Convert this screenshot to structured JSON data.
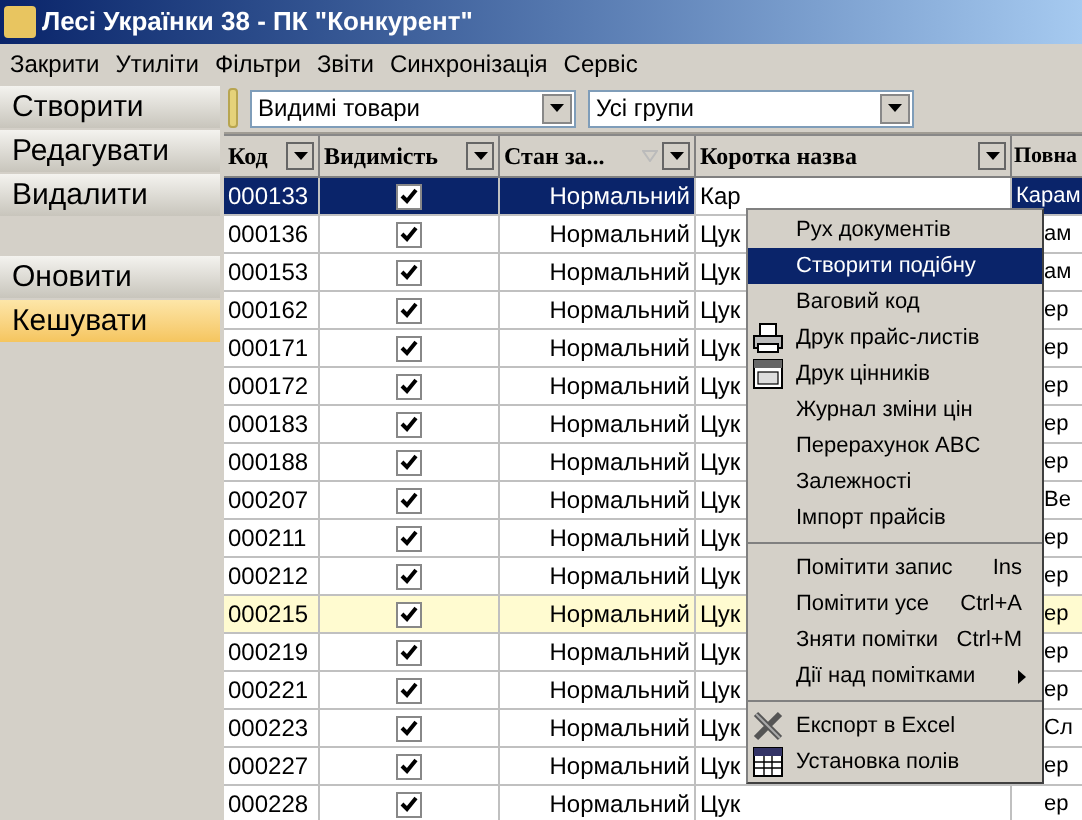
{
  "window": {
    "title": "Лесі Українки 38 - ПК \"Конкурент\""
  },
  "menu_bar": [
    "Закрити",
    "Утиліти",
    "Фільтри",
    "Звіти",
    "Синхронізація",
    "Сервіс"
  ],
  "sidebar": {
    "groups": [
      [
        {
          "label": "Створити",
          "selected": false
        },
        {
          "label": "Редагувати",
          "selected": false
        },
        {
          "label": "Видалити",
          "selected": false
        }
      ],
      [
        {
          "label": "Оновити",
          "selected": false
        },
        {
          "label": "Кешувати",
          "selected": true
        }
      ]
    ]
  },
  "filters": [
    {
      "value": "Видимі товари"
    },
    {
      "value": "Усі групи"
    }
  ],
  "table": {
    "columns": [
      {
        "label": "Код",
        "sorted": false
      },
      {
        "label": "Видимість",
        "sorted": false
      },
      {
        "label": "Стан за...",
        "sorted": true
      },
      {
        "label": "Коротка назва",
        "sorted": false
      },
      {
        "label": "Повна"
      }
    ],
    "rows": [
      {
        "code": "000133",
        "visible": true,
        "state": "Нормальний",
        "short": "Кар",
        "full": "Карам",
        "selected": true,
        "highlighted": false
      },
      {
        "code": "000136",
        "visible": true,
        "state": "Нормальний",
        "short": "Цук",
        "full": "ам",
        "selected": false,
        "highlighted": false
      },
      {
        "code": "000153",
        "visible": true,
        "state": "Нормальний",
        "short": "Цук",
        "full": "ам",
        "selected": false,
        "highlighted": false
      },
      {
        "code": "000162",
        "visible": true,
        "state": "Нормальний",
        "short": "Цук",
        "full": "ер",
        "selected": false,
        "highlighted": false
      },
      {
        "code": "000171",
        "visible": true,
        "state": "Нормальний",
        "short": "Цук",
        "full": "ер",
        "selected": false,
        "highlighted": false
      },
      {
        "code": "000172",
        "visible": true,
        "state": "Нормальний",
        "short": "Цук",
        "full": "ер",
        "selected": false,
        "highlighted": false
      },
      {
        "code": "000183",
        "visible": true,
        "state": "Нормальний",
        "short": "Цук",
        "full": "ер",
        "selected": false,
        "highlighted": false
      },
      {
        "code": "000188",
        "visible": true,
        "state": "Нормальний",
        "short": "Цук",
        "full": "ер",
        "selected": false,
        "highlighted": false
      },
      {
        "code": "000207",
        "visible": true,
        "state": "Нормальний",
        "short": "Цук",
        "full": "Ве",
        "selected": false,
        "highlighted": false
      },
      {
        "code": "000211",
        "visible": true,
        "state": "Нормальний",
        "short": "Цук",
        "full": "ер",
        "selected": false,
        "highlighted": false
      },
      {
        "code": "000212",
        "visible": true,
        "state": "Нормальний",
        "short": "Цук",
        "full": "ер",
        "selected": false,
        "highlighted": false
      },
      {
        "code": "000215",
        "visible": true,
        "state": "Нормальний",
        "short": "Цук",
        "full": "ер",
        "selected": false,
        "highlighted": true
      },
      {
        "code": "000219",
        "visible": true,
        "state": "Нормальний",
        "short": "Цук",
        "full": "ер",
        "selected": false,
        "highlighted": false
      },
      {
        "code": "000221",
        "visible": true,
        "state": "Нормальний",
        "short": "Цук",
        "full": "ер",
        "selected": false,
        "highlighted": false
      },
      {
        "code": "000223",
        "visible": true,
        "state": "Нормальний",
        "short": "Цук",
        "full": "Сл",
        "selected": false,
        "highlighted": false
      },
      {
        "code": "000227",
        "visible": true,
        "state": "Нормальний",
        "short": "Цук",
        "full": "ер",
        "selected": false,
        "highlighted": false
      },
      {
        "code": "000228",
        "visible": true,
        "state": "Нормальний",
        "short": "Цук",
        "full": "ер",
        "selected": false,
        "highlighted": false
      }
    ]
  },
  "context_menu": {
    "groups": [
      [
        {
          "label": "Рух документів",
          "selected": false
        },
        {
          "label": "Створити подібну",
          "selected": true
        },
        {
          "label": "Ваговий код",
          "selected": false
        },
        {
          "label": "Друк прайс-листів",
          "selected": false
        },
        {
          "label": "Друк цінників",
          "selected": false
        },
        {
          "label": "Журнал зміни цін",
          "selected": false
        },
        {
          "label": "Перерахунок ABC",
          "selected": false
        },
        {
          "label": "Залежності",
          "selected": false
        },
        {
          "label": "Імпорт прайсів",
          "selected": false
        }
      ],
      [
        {
          "label": "Помітити запис",
          "shortcut": "Ins",
          "selected": false
        },
        {
          "label": "Помітити усе",
          "shortcut": "Ctrl+A",
          "selected": false
        },
        {
          "label": "Зняти помітки",
          "shortcut": "Ctrl+M",
          "selected": false
        },
        {
          "label": "Дії над помітками",
          "submenu": true,
          "selected": false
        }
      ],
      [
        {
          "label": "Експорт в Excel",
          "selected": false
        },
        {
          "label": "Установка полів",
          "selected": false
        }
      ]
    ]
  }
}
